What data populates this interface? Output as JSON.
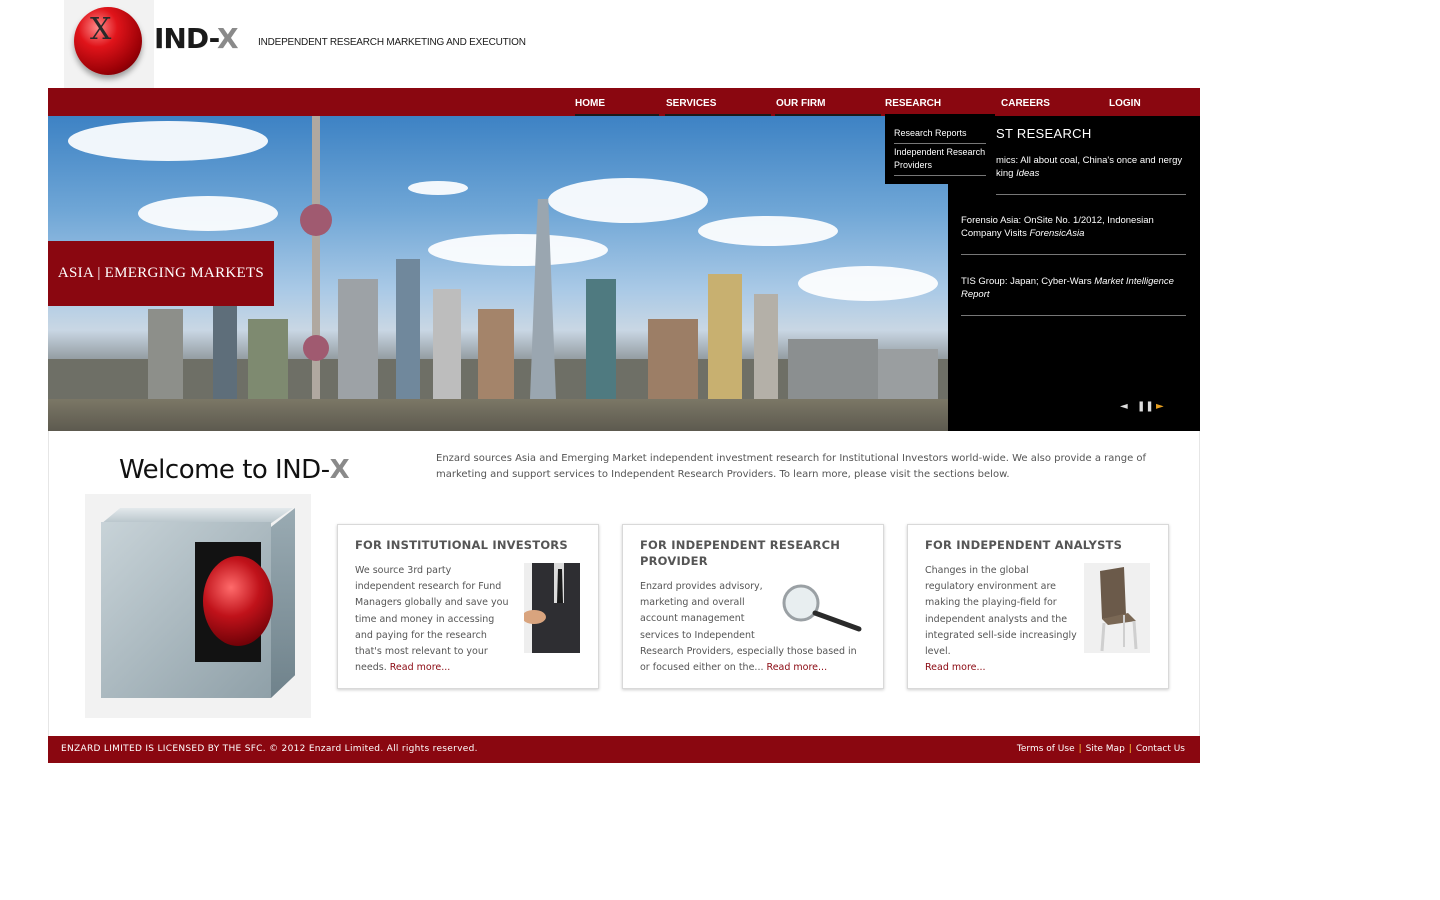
{
  "header": {
    "logo_x": "X",
    "brand_prefix": "IND-",
    "brand_suffix": "X",
    "tagline": "INDEPENDENT RESEARCH MARKETING AND EXECUTION"
  },
  "nav": {
    "items": [
      {
        "label": "HOME"
      },
      {
        "label": "SERVICES"
      },
      {
        "label": "OUR FIRM"
      },
      {
        "label": "RESEARCH"
      },
      {
        "label": "CAREERS"
      },
      {
        "label": "LOGIN"
      }
    ],
    "active": "RESEARCH"
  },
  "dropdown": {
    "items": [
      {
        "label": "Research Reports"
      },
      {
        "label": "Independent Research Providers"
      }
    ]
  },
  "hero": {
    "label": "ASIA | EMERGING MARKETS"
  },
  "panel": {
    "title_visible": "ST RESEARCH",
    "items": [
      {
        "text": "mics: All about coal, China's once and nergy king",
        "tag": "Ideas"
      },
      {
        "text": "Forensio Asia: OnSite No. 1/2012, Indonesian Company Visits",
        "tag": "ForensicAsia"
      },
      {
        "text": "TIS Group: Japan; Cyber-Wars",
        "tag": "Market Intelligence Report"
      }
    ],
    "controls": {
      "prev": "◄",
      "pause": "❚❚",
      "next": "►"
    },
    "colors": {
      "next_arrow": "#e8a020"
    }
  },
  "content": {
    "welcome_prefix": "Welcome to IND-",
    "welcome_suffix": "X",
    "intro": "Enzard sources Asia and Emerging Market independent investment research for Institutional Investors world-wide. We also provide a range of marketing and support services to Independent Research Providers. To learn more, please visit the sections below.",
    "cards": [
      {
        "title": "FOR INSTITUTIONAL INVESTORS",
        "lines": [
          "We source 3rd party",
          "independent research for Fund",
          "Managers globally and save you",
          "time and money in accessing",
          "and paying for the research",
          "that's most relevant to your"
        ],
        "last_line": "needs.",
        "read_more": "Read more...",
        "icon": "handshake-businessman"
      },
      {
        "title": "FOR INDEPENDENT RESEARCH PROVIDER",
        "lines": [
          "Enzard provides advisory,",
          "marketing and overall",
          "account management",
          "services to Independent",
          "Research Providers, especially those based in"
        ],
        "last_line": "or focused either on the...",
        "read_more": "Read more...",
        "icon": "magnifying-glass"
      },
      {
        "title": "FOR INDEPENDENT ANALYSTS",
        "lines": [
          "Changes in the global",
          "regulatory environment are",
          "making the playing-field for",
          "independent analysts and the",
          "integrated sell-side increasingly",
          "level."
        ],
        "last_line": "",
        "read_more": "Read more...",
        "icon": "chair"
      }
    ]
  },
  "footer": {
    "copyright": "ENZARD LIMITED IS LICENSED BY THE SFC. © 2012 Enzard Limited. All rights reserved.",
    "links": [
      {
        "label": "Terms of Use"
      },
      {
        "label": "Site Map"
      },
      {
        "label": "Contact Us"
      }
    ]
  },
  "colors": {
    "brand_red": "#8a0710",
    "panel_bg": "#000000",
    "text_gray": "#555555",
    "footer_separator": "#ffcc33"
  }
}
